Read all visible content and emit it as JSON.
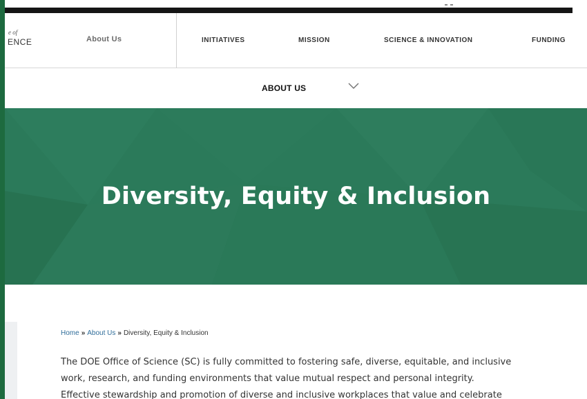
{
  "logo": {
    "line1": "e of",
    "line2": "ENCE"
  },
  "nav": {
    "about_label": "About Us",
    "links": [
      "INITIATIVES",
      "MISSION",
      "SCIENCE & INNOVATION",
      "FUNDING"
    ]
  },
  "subnav": {
    "label": "ABOUT US"
  },
  "hero": {
    "title": "Diversity, Equity & Inclusion"
  },
  "breadcrumb": {
    "home": "Home",
    "separator": "»",
    "about": "About Us",
    "current": "Diversity, Equity & Inclusion"
  },
  "intro": {
    "line1": "The DOE Office of Science (SC) is fully committed to fostering safe, diverse, equitable, and inclusive",
    "line2": "work, research, and funding environments that value mutual respect and personal integrity.",
    "line3": "Effective stewardship and promotion of diverse and inclusive workplaces that value and celebrate"
  },
  "colors": {
    "hero_green": "#2b7a5a",
    "frame_green": "#1d6a3f",
    "link_blue": "#2f6d9a"
  },
  "icons": {
    "subnav_toggle": "chevron-down-icon"
  }
}
